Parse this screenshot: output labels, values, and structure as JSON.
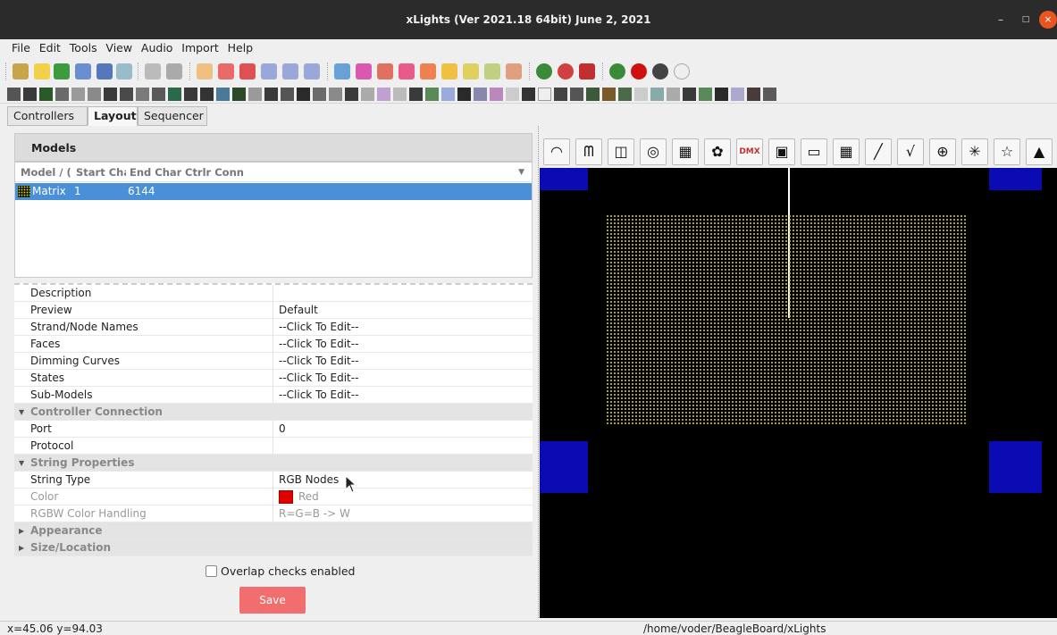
{
  "window": {
    "title": "xLights (Ver 2021.18 64bit) June 2, 2021",
    "min": "–",
    "max": "□",
    "close": "×"
  },
  "menu": [
    "File",
    "Edit",
    "Tools",
    "View",
    "Audio",
    "Import",
    "Help"
  ],
  "tabs": [
    "Controllers",
    "Layout",
    "Sequencer"
  ],
  "models_panel": {
    "title": "Models",
    "columns": [
      "Model / (",
      "Start Cha",
      "End Char",
      "Ctrlr Conn"
    ],
    "rows": [
      {
        "model": "Matrix",
        "start": "1",
        "end": "6144",
        "conn": ""
      }
    ]
  },
  "properties": [
    {
      "key": "Description",
      "value": ""
    },
    {
      "key": "Preview",
      "value": "Default"
    },
    {
      "key": "Strand/Node Names",
      "value": "--Click To Edit--"
    },
    {
      "key": "Faces",
      "value": "--Click To Edit--"
    },
    {
      "key": "Dimming Curves",
      "value": "--Click To Edit--"
    },
    {
      "key": "States",
      "value": "--Click To Edit--"
    },
    {
      "key": "Sub-Models",
      "value": "--Click To Edit--"
    },
    {
      "key": "Controller Connection",
      "category": true
    },
    {
      "key": "Port",
      "value": "0"
    },
    {
      "key": "Protocol",
      "value": ""
    },
    {
      "key": "String Properties",
      "category": true
    },
    {
      "key": "String Type",
      "value": "RGB Nodes"
    },
    {
      "key": "Color",
      "value": "Red",
      "disabled": true
    },
    {
      "key": "RGBW Color Handling",
      "value": "R=G=B -> W",
      "disabled": true
    },
    {
      "key": "Appearance",
      "category": true,
      "collapsed": true
    },
    {
      "key": "Size/Location",
      "category": true,
      "collapsed": true
    }
  ],
  "overlap_label": "Overlap checks enabled",
  "save_label": "Save",
  "status": {
    "coords": "x=45.06 y=94.03",
    "path": "/home/voder/BeagleBoard/xLights"
  },
  "colors": {
    "accent_blue": "#4a90d9",
    "save_red": "#f26d6d",
    "node_blue": "#0b0bb3",
    "matrix_yellow": "#d7d400"
  },
  "icons": {
    "layout_tools": [
      "arch-icon",
      "candy-cane-icon",
      "window-frame-icon",
      "circle-icon",
      "spinner-icon",
      "star-wreath-icon",
      "dmx-icon",
      "image-icon",
      "icicles-icon",
      "matrix-icon",
      "single-line-icon",
      "poly-line-icon",
      "sphere-icon",
      "starburst-icon",
      "star-icon",
      "tree-icon"
    ],
    "layout_tool_glyphs": [
      "◠",
      "ᗰ",
      "◫",
      "◎",
      "▦",
      "✿",
      "DMX",
      "▣",
      "▭",
      "▦",
      "╱",
      "√",
      "⊕",
      "✳",
      "☆",
      "▲"
    ]
  }
}
